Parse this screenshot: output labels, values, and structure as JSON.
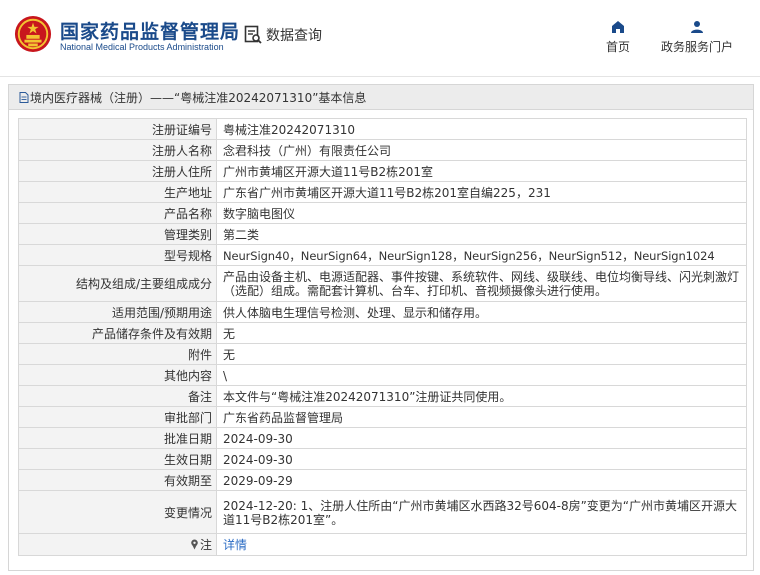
{
  "header": {
    "brand_cn": "国家药品监督管理局",
    "brand_en": "National Medical Products Administration",
    "query_label": "数据查询",
    "nav_home": "首页",
    "nav_gov": "政务服务门户"
  },
  "panel": {
    "title": "境内医疗器械（注册）——“粤械注准20242071310”基本信息"
  },
  "rows": [
    {
      "label": "注册证编号",
      "value": "粤械注准20242071310"
    },
    {
      "label": "注册人名称",
      "value": "念君科技（广州）有限责任公司"
    },
    {
      "label": "注册人住所",
      "value": "广州市黄埔区开源大道11号B2栋201室"
    },
    {
      "label": "生产地址",
      "value": "广东省广州市黄埔区开源大道11号B2栋201室自编225，231"
    },
    {
      "label": "产品名称",
      "value": "数字脑电图仪"
    },
    {
      "label": "管理类别",
      "value": "第二类"
    },
    {
      "label": "型号规格",
      "value": "NeurSign40，NeurSign64，NeurSign128，NeurSign256，NeurSign512，NeurSign1024"
    },
    {
      "label": "结构及组成/主要组成成分",
      "value": "产品由设备主机、电源适配器、事件按键、系统软件、网线、级联线、电位均衡导线、闪光刺激灯（选配）组成。需配套计算机、台车、打印机、音视频摄像头进行使用。"
    },
    {
      "label": "适用范围/预期用途",
      "value": "供人体脑电生理信号检测、处理、显示和储存用。"
    },
    {
      "label": "产品储存条件及有效期",
      "value": "无"
    },
    {
      "label": "附件",
      "value": "无"
    },
    {
      "label": "其他内容",
      "value": "\\"
    },
    {
      "label": "备注",
      "value": "本文件与“粤械注准20242071310”注册证共同使用。"
    },
    {
      "label": "审批部门",
      "value": "广东省药品监督管理局"
    },
    {
      "label": "批准日期",
      "value": "2024-09-30"
    },
    {
      "label": "生效日期",
      "value": "2024-09-30"
    },
    {
      "label": "有效期至",
      "value": "2029-09-29"
    },
    {
      "label": "变更情况",
      "value": "2024-12-20: 1、注册人住所由“广州市黄埔区水西路32号604-8房”变更为“广州市黄埔区开源大道11号B2栋201室”。"
    },
    {
      "label": "注",
      "value": "详情"
    }
  ],
  "colors": {
    "brand": "#1a4a8a",
    "link": "#2b6cc4",
    "label_bg": "#f3f3f3",
    "header_bar_bg": "#ececec"
  },
  "icons": {
    "logo": "national-emblem-icon",
    "query": "document-search-icon",
    "home": "home-icon",
    "gov": "user-icon",
    "panel": "document-icon",
    "note": "pin-icon"
  }
}
